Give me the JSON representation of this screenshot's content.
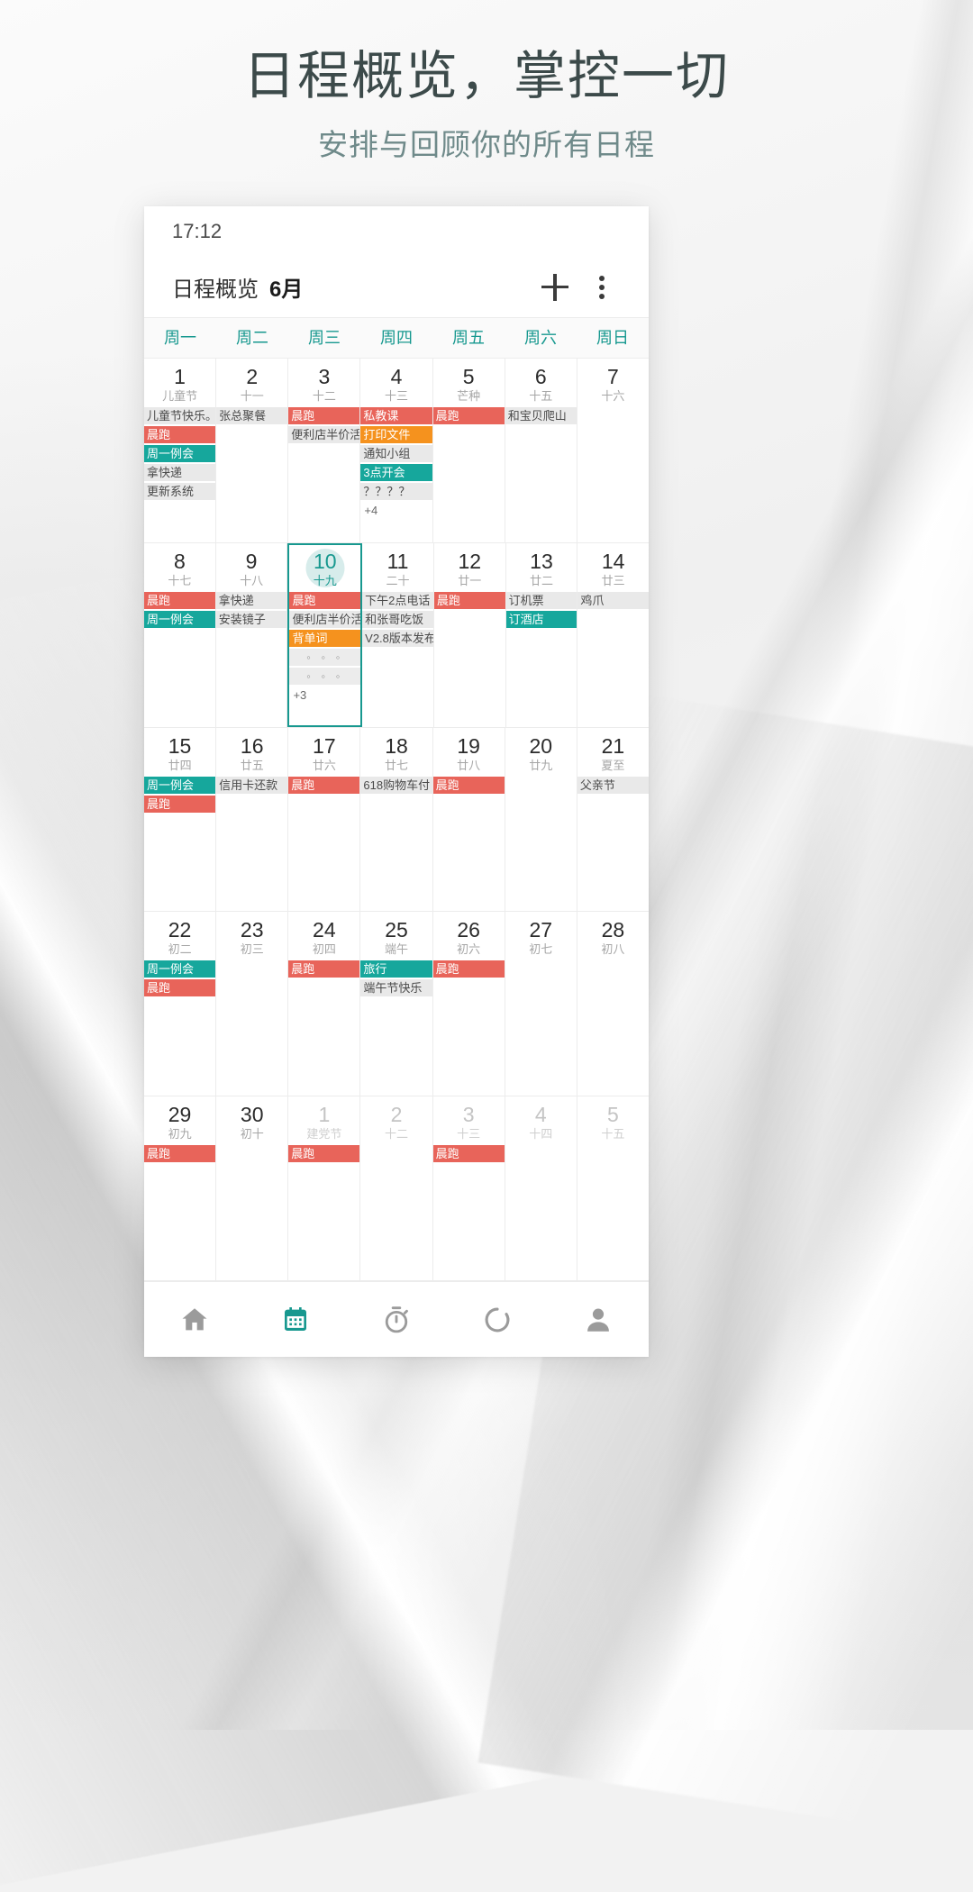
{
  "promo": {
    "headline": "日程概览，掌控一切",
    "subhead": "安排与回顾你的所有日程"
  },
  "phone": {
    "status": {
      "time": "17:12"
    },
    "appbar": {
      "title": "日程概览",
      "month": "6月",
      "add_icon": "plus-icon",
      "menu_icon": "more-vertical-icon"
    },
    "weekdays": [
      "周一",
      "周二",
      "周三",
      "周四",
      "周五",
      "周六",
      "周日"
    ],
    "accent": "#17988f",
    "event_colors": {
      "red": "#e8645a",
      "teal": "#16a79c",
      "orange": "#f5921e",
      "gray": "#e9e9e9"
    },
    "weeks": [
      [
        {
          "num": "1",
          "lunar": "儿童节",
          "dim": false,
          "today": false,
          "selected": false,
          "events": [
            {
              "t": "儿童节快乐。",
              "c": "gray"
            },
            {
              "t": "晨跑",
              "c": "red"
            },
            {
              "t": "周一例会",
              "c": "teal"
            },
            {
              "t": "拿快递",
              "c": "gray"
            },
            {
              "t": "更新系统",
              "c": "gray"
            }
          ]
        },
        {
          "num": "2",
          "lunar": "十一",
          "dim": false,
          "today": false,
          "selected": false,
          "events": [
            {
              "t": "张总聚餐",
              "c": "gray"
            }
          ]
        },
        {
          "num": "3",
          "lunar": "十二",
          "dim": false,
          "today": false,
          "selected": false,
          "events": [
            {
              "t": "晨跑",
              "c": "red"
            },
            {
              "t": "便利店半价活",
              "c": "gray"
            }
          ]
        },
        {
          "num": "4",
          "lunar": "十三",
          "dim": false,
          "today": false,
          "selected": false,
          "events": [
            {
              "t": "私教课",
              "c": "red"
            },
            {
              "t": "打印文件",
              "c": "orange"
            },
            {
              "t": "通知小组",
              "c": "gray"
            },
            {
              "t": "3点开会",
              "c": "teal"
            },
            {
              "t": "？？？？",
              "c": "gray"
            },
            {
              "t": "+4",
              "c": "more"
            }
          ]
        },
        {
          "num": "5",
          "lunar": "芒种",
          "dim": false,
          "today": false,
          "selected": false,
          "events": [
            {
              "t": "晨跑",
              "c": "red"
            }
          ]
        },
        {
          "num": "6",
          "lunar": "十五",
          "dim": false,
          "today": false,
          "selected": false,
          "events": [
            {
              "t": "和宝贝爬山",
              "c": "gray"
            }
          ]
        },
        {
          "num": "7",
          "lunar": "十六",
          "dim": false,
          "today": false,
          "selected": false,
          "events": []
        }
      ],
      [
        {
          "num": "8",
          "lunar": "十七",
          "dim": false,
          "today": false,
          "selected": false,
          "events": [
            {
              "t": "晨跑",
              "c": "red"
            },
            {
              "t": "周一例会",
              "c": "teal"
            }
          ]
        },
        {
          "num": "9",
          "lunar": "十八",
          "dim": false,
          "today": false,
          "selected": false,
          "events": [
            {
              "t": "拿快递",
              "c": "gray"
            },
            {
              "t": "安装镜子",
              "c": "gray"
            }
          ]
        },
        {
          "num": "10",
          "lunar": "十九",
          "dim": false,
          "today": true,
          "selected": true,
          "events": [
            {
              "t": "晨跑",
              "c": "red"
            },
            {
              "t": "便利店半价活",
              "c": "gray"
            },
            {
              "t": "背单词",
              "c": "orange"
            },
            {
              "t": "◦ ◦ ◦",
              "c": "dots"
            },
            {
              "t": "◦ ◦ ◦",
              "c": "dots"
            },
            {
              "t": "+3",
              "c": "more"
            }
          ]
        },
        {
          "num": "11",
          "lunar": "二十",
          "dim": false,
          "today": false,
          "selected": false,
          "events": [
            {
              "t": "下午2点电话",
              "c": "gray"
            },
            {
              "t": "和张哥吃饭",
              "c": "gray"
            },
            {
              "t": "V2.8版本发布",
              "c": "gray"
            }
          ]
        },
        {
          "num": "12",
          "lunar": "廿一",
          "dim": false,
          "today": false,
          "selected": false,
          "events": [
            {
              "t": "晨跑",
              "c": "red"
            }
          ]
        },
        {
          "num": "13",
          "lunar": "廿二",
          "dim": false,
          "today": false,
          "selected": false,
          "events": [
            {
              "t": "订机票",
              "c": "gray"
            },
            {
              "t": "订酒店",
              "c": "teal"
            }
          ]
        },
        {
          "num": "14",
          "lunar": "廿三",
          "dim": false,
          "today": false,
          "selected": false,
          "events": [
            {
              "t": "鸡爪",
              "c": "gray"
            }
          ]
        }
      ],
      [
        {
          "num": "15",
          "lunar": "廿四",
          "dim": false,
          "today": false,
          "selected": false,
          "events": [
            {
              "t": "周一例会",
              "c": "teal"
            },
            {
              "t": "晨跑",
              "c": "red"
            }
          ]
        },
        {
          "num": "16",
          "lunar": "廿五",
          "dim": false,
          "today": false,
          "selected": false,
          "events": [
            {
              "t": "信用卡还款",
              "c": "gray"
            }
          ]
        },
        {
          "num": "17",
          "lunar": "廿六",
          "dim": false,
          "today": false,
          "selected": false,
          "events": [
            {
              "t": "晨跑",
              "c": "red"
            }
          ]
        },
        {
          "num": "18",
          "lunar": "廿七",
          "dim": false,
          "today": false,
          "selected": false,
          "events": [
            {
              "t": "618购物车付",
              "c": "gray"
            }
          ]
        },
        {
          "num": "19",
          "lunar": "廿八",
          "dim": false,
          "today": false,
          "selected": false,
          "events": [
            {
              "t": "晨跑",
              "c": "red"
            }
          ]
        },
        {
          "num": "20",
          "lunar": "廿九",
          "dim": false,
          "today": false,
          "selected": false,
          "events": []
        },
        {
          "num": "21",
          "lunar": "夏至",
          "dim": false,
          "today": false,
          "selected": false,
          "events": [
            {
              "t": "父亲节",
              "c": "gray"
            }
          ]
        }
      ],
      [
        {
          "num": "22",
          "lunar": "初二",
          "dim": false,
          "today": false,
          "selected": false,
          "events": [
            {
              "t": "周一例会",
              "c": "teal"
            },
            {
              "t": "晨跑",
              "c": "red"
            }
          ]
        },
        {
          "num": "23",
          "lunar": "初三",
          "dim": false,
          "today": false,
          "selected": false,
          "events": []
        },
        {
          "num": "24",
          "lunar": "初四",
          "dim": false,
          "today": false,
          "selected": false,
          "events": [
            {
              "t": "晨跑",
              "c": "red"
            }
          ]
        },
        {
          "num": "25",
          "lunar": "端午",
          "dim": false,
          "today": false,
          "selected": false,
          "events": [
            {
              "t": "旅行",
              "c": "teal"
            },
            {
              "t": "端午节快乐",
              "c": "gray"
            }
          ]
        },
        {
          "num": "26",
          "lunar": "初六",
          "dim": false,
          "today": false,
          "selected": false,
          "events": [
            {
              "t": "晨跑",
              "c": "red"
            }
          ]
        },
        {
          "num": "27",
          "lunar": "初七",
          "dim": false,
          "today": false,
          "selected": false,
          "events": []
        },
        {
          "num": "28",
          "lunar": "初八",
          "dim": false,
          "today": false,
          "selected": false,
          "events": []
        }
      ],
      [
        {
          "num": "29",
          "lunar": "初九",
          "dim": false,
          "today": false,
          "selected": false,
          "events": [
            {
              "t": "晨跑",
              "c": "red"
            }
          ]
        },
        {
          "num": "30",
          "lunar": "初十",
          "dim": false,
          "today": false,
          "selected": false,
          "events": []
        },
        {
          "num": "1",
          "lunar": "建党节",
          "dim": true,
          "today": false,
          "selected": false,
          "events": [
            {
              "t": "晨跑",
              "c": "red"
            }
          ]
        },
        {
          "num": "2",
          "lunar": "十二",
          "dim": true,
          "today": false,
          "selected": false,
          "events": []
        },
        {
          "num": "3",
          "lunar": "十三",
          "dim": true,
          "today": false,
          "selected": false,
          "events": [
            {
              "t": "晨跑",
              "c": "red"
            }
          ]
        },
        {
          "num": "4",
          "lunar": "十四",
          "dim": true,
          "today": false,
          "selected": false,
          "events": []
        },
        {
          "num": "5",
          "lunar": "十五",
          "dim": true,
          "today": false,
          "selected": false,
          "events": []
        }
      ]
    ],
    "nav": [
      {
        "icon": "home-icon",
        "active": false
      },
      {
        "icon": "calendar-icon",
        "active": true
      },
      {
        "icon": "timer-icon",
        "active": false
      },
      {
        "icon": "progress-ring-icon",
        "active": false
      },
      {
        "icon": "person-icon",
        "active": false
      }
    ]
  }
}
